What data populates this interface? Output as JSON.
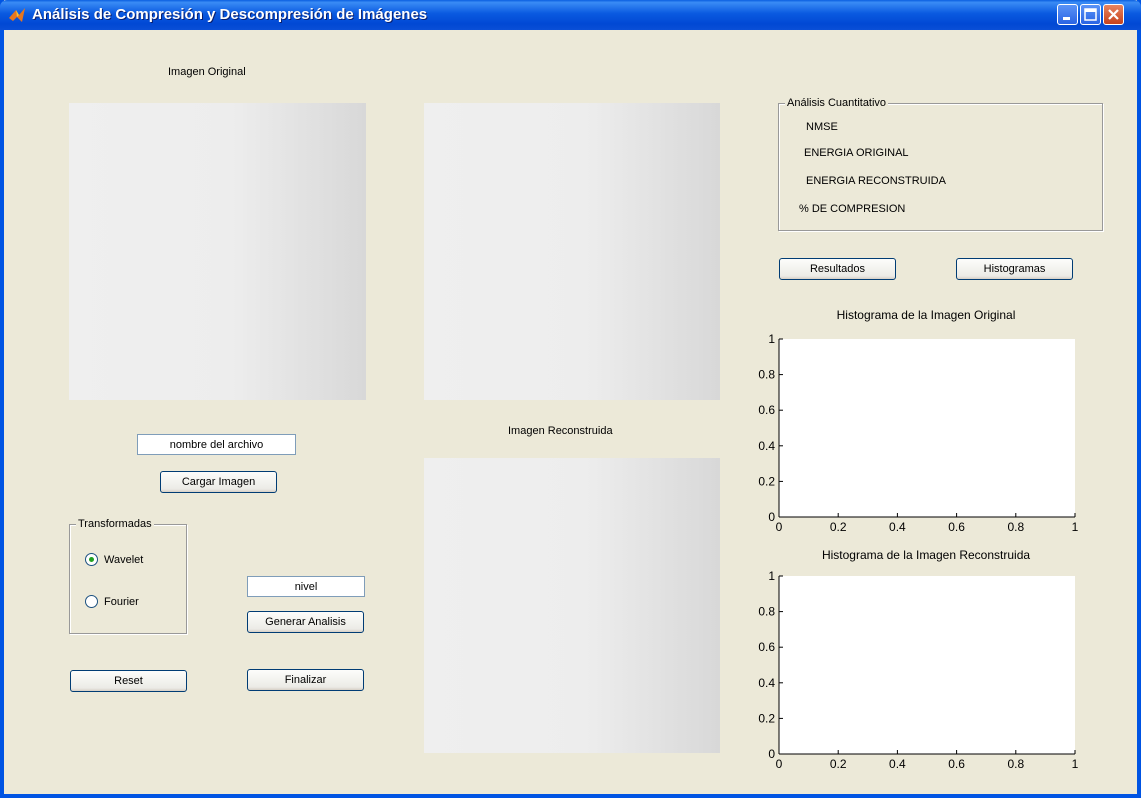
{
  "window": {
    "title": "Análisis de Compresión y Descompresión de Imágenes"
  },
  "labels": {
    "original_image": "Imagen Original",
    "reconstructed_image": "Imagen Reconstruida"
  },
  "file_input": {
    "value": "nombre del archivo"
  },
  "buttons": {
    "load": "Cargar Imagen",
    "generate": "Generar Analisis",
    "reset": "Reset",
    "finish": "Finalizar",
    "results": "Resultados",
    "histograms": "Histogramas"
  },
  "level_input": {
    "value": "nivel"
  },
  "transforms": {
    "title": "Transformadas",
    "options": [
      {
        "label": "Wavelet",
        "selected": true
      },
      {
        "label": "Fourier",
        "selected": false
      }
    ]
  },
  "quantitative": {
    "title": "Análisis Cuantitativo",
    "items": [
      "NMSE",
      "ENERGIA ORIGINAL",
      "ENERGIA RECONSTRUIDA",
      "% DE COMPRESION"
    ]
  },
  "chart_data": [
    {
      "type": "line",
      "title": "Histograma de la Imagen Original",
      "xlim": [
        0,
        1
      ],
      "ylim": [
        0,
        1
      ],
      "xticks": [
        "0",
        "0.2",
        "0.4",
        "0.6",
        "0.8",
        "1"
      ],
      "yticks": [
        "0",
        "0.2",
        "0.4",
        "0.6",
        "0.8",
        "1"
      ],
      "series": []
    },
    {
      "type": "line",
      "title": "Histograma de la Imagen Reconstruida",
      "xlim": [
        0,
        1
      ],
      "ylim": [
        0,
        1
      ],
      "xticks": [
        "0",
        "0.2",
        "0.4",
        "0.6",
        "0.8",
        "1"
      ],
      "yticks": [
        "0",
        "0.2",
        "0.4",
        "0.6",
        "0.8",
        "1"
      ],
      "series": []
    }
  ],
  "colors": {
    "titlebar": "#0054e3",
    "background": "#ece9d8",
    "radio_selected": "#21a121"
  }
}
